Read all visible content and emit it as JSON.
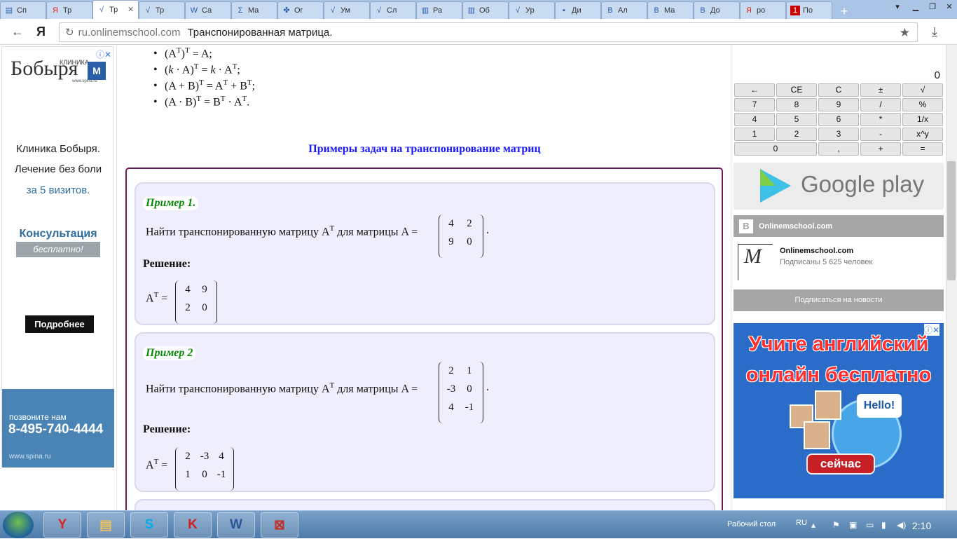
{
  "tabs": [
    {
      "icon": "doc-icon",
      "label": "Сп"
    },
    {
      "icon": "yandex-icon",
      "label": "Тр"
    },
    {
      "icon": "sqrt-icon",
      "label": "Тр",
      "active": true
    },
    {
      "icon": "sqrt-icon",
      "label": "Тр"
    },
    {
      "icon": "wordpress-icon",
      "label": "Са"
    },
    {
      "icon": "sigma-icon",
      "label": "Ма"
    },
    {
      "icon": "clover-icon",
      "label": "Ог"
    },
    {
      "icon": "sqrt-icon",
      "label": "Ум"
    },
    {
      "icon": "sqrt-icon",
      "label": "Сл"
    },
    {
      "icon": "book-icon",
      "label": "Ра"
    },
    {
      "icon": "book-icon",
      "label": "Об"
    },
    {
      "icon": "sqrt-icon",
      "label": "Ур"
    },
    {
      "icon": "chat-icon",
      "label": "Ди"
    },
    {
      "icon": "vk-icon",
      "label": "Ал"
    },
    {
      "icon": "vk-icon",
      "label": "Ма"
    },
    {
      "icon": "vk-icon",
      "label": "До"
    },
    {
      "icon": "yandex-icon",
      "label": "ро"
    },
    {
      "icon": "channel-one-icon",
      "label": "По"
    }
  ],
  "browser": {
    "new_tab": "+",
    "address_domain": "ru.onlinemschool.com",
    "page_title": "Транспонированная матрица.",
    "yandex_logo": "Я"
  },
  "properties": [
    {
      "html": "(A<sup>T</sup>)<sup>T</sup> = A;"
    },
    {
      "html": "(<i>k</i> · A)<sup>T</sup> = <i>k</i> · A<sup>T</sup>;"
    },
    {
      "html": "(A + B)<sup>T</sup> = A<sup>T</sup> + B<sup>T</sup>;"
    },
    {
      "html": "(A · B)<sup>T</sup> = B<sup>T</sup> · A<sup>T</sup>."
    }
  ],
  "section_heading": "Примеры задач на транспонирование матриц",
  "examples": [
    {
      "title": "Пример 1.",
      "question_prefix": "Найти транспонированную матрицу A",
      "question_mid": " для матрицы A = ",
      "matrix": [
        [
          "4",
          "2"
        ],
        [
          "9",
          "0"
        ]
      ],
      "solution_label": "Решение:",
      "answer": [
        [
          "4",
          "9"
        ],
        [
          "2",
          "0"
        ]
      ]
    },
    {
      "title": "Пример 2",
      "question_prefix": "Найти транспонированную матрицу A",
      "question_mid": " для матрицы A = ",
      "matrix": [
        [
          "2",
          "1"
        ],
        [
          "-3",
          "0"
        ],
        [
          "4",
          "-1"
        ]
      ],
      "solution_label": "Решение:",
      "answer": [
        [
          "2",
          "-3",
          "4"
        ],
        [
          "1",
          "0",
          "-1"
        ]
      ]
    }
  ],
  "left_ad": {
    "logo_small": "КЛИНИКА",
    "logo_big": "Бобыря",
    "logo_url": "www.spina.ru",
    "line1": "Клиника Бобыря.",
    "line2": "Лечение без боли",
    "line3": "за 5 визитов.",
    "consult": "Консультация",
    "free": "бесплатно!",
    "more": "Подробнее",
    "call": "позвоните нам",
    "phone": "8-495-740-4444",
    "site": "www.spina.ru"
  },
  "calculator": {
    "display": "0",
    "rows": [
      [
        "←",
        "CE",
        "C",
        "±",
        "√"
      ],
      [
        "7",
        "8",
        "9",
        "/",
        "%"
      ],
      [
        "4",
        "5",
        "6",
        "*",
        "1/x"
      ],
      [
        "1",
        "2",
        "3",
        "-",
        "x^y"
      ],
      [
        "0",
        ",",
        "+",
        "="
      ]
    ]
  },
  "google_play": "Google play",
  "vk_widget": {
    "header": "Onlinemschool.com",
    "name": "Onlinemschool.com",
    "subscribers": "Подписаны 5 625 человек",
    "subscribe": "Подписаться на новости"
  },
  "english_ad": {
    "line1": "Учите английский",
    "line2": "онлайн бесплатно",
    "hello": "Hello!",
    "cta": "сейчас"
  },
  "taskbar": {
    "desktop_label": "Рабочий стол",
    "lang": "RU",
    "time": "2:10",
    "apps": [
      {
        "icon": "yandex-browser-icon",
        "glyph": "Y",
        "color": "#e02020"
      },
      {
        "icon": "file-explorer-icon",
        "glyph": "▤",
        "color": "#e8c060"
      },
      {
        "icon": "skype-icon",
        "glyph": "S",
        "color": "#00aff0"
      },
      {
        "icon": "kaspersky-icon",
        "glyph": "K",
        "color": "#d02020"
      },
      {
        "icon": "word-icon",
        "glyph": "W",
        "color": "#2b579a"
      },
      {
        "icon": "pdf-reader-icon",
        "glyph": "⊠",
        "color": "#c0302a"
      }
    ]
  }
}
